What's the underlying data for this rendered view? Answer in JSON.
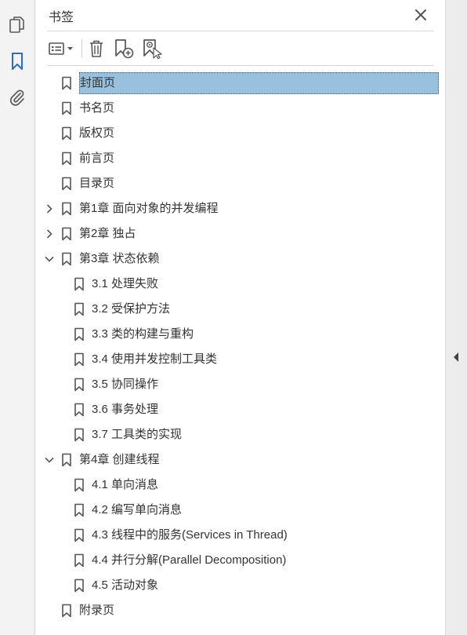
{
  "panel": {
    "title": "书签",
    "icons": {
      "close": "close-icon",
      "options": "options-menu-icon",
      "delete": "trash-icon",
      "new_bookmark": "new-bookmark-icon",
      "find_bookmark": "find-current-bookmark-icon",
      "pages": "pages-icon",
      "bookmarks": "bookmark-icon",
      "attachments": "paperclip-icon",
      "collapse": "collapse-left-icon"
    }
  },
  "colors": {
    "selection": "#99c1de",
    "active_rail_icon": "#2b6cc4"
  },
  "bookmarks": [
    {
      "label": "封面页",
      "level": 0,
      "toggle": "none",
      "selected": true
    },
    {
      "label": "书名页",
      "level": 0,
      "toggle": "none",
      "selected": false
    },
    {
      "label": "版权页",
      "level": 0,
      "toggle": "none",
      "selected": false
    },
    {
      "label": "前言页",
      "level": 0,
      "toggle": "none",
      "selected": false
    },
    {
      "label": "目录页",
      "level": 0,
      "toggle": "none",
      "selected": false
    },
    {
      "label": "第1章  面向对象的并发编程",
      "level": 0,
      "toggle": "collapsed",
      "selected": false
    },
    {
      "label": "第2章  独占",
      "level": 0,
      "toggle": "collapsed",
      "selected": false
    },
    {
      "label": "第3章  状态依赖",
      "level": 0,
      "toggle": "expanded",
      "selected": false
    },
    {
      "label": "3.1  处理失败",
      "level": 1,
      "toggle": "none",
      "selected": false
    },
    {
      "label": "3.2  受保护方法",
      "level": 1,
      "toggle": "none",
      "selected": false
    },
    {
      "label": "3.3  类的构建与重构",
      "level": 1,
      "toggle": "none",
      "selected": false
    },
    {
      "label": "3.4  使用并发控制工具类",
      "level": 1,
      "toggle": "none",
      "selected": false
    },
    {
      "label": "3.5  协同操作",
      "level": 1,
      "toggle": "none",
      "selected": false
    },
    {
      "label": "3.6  事务处理",
      "level": 1,
      "toggle": "none",
      "selected": false
    },
    {
      "label": "3.7  工具类的实现",
      "level": 1,
      "toggle": "none",
      "selected": false
    },
    {
      "label": "第4章  创建线程",
      "level": 0,
      "toggle": "expanded",
      "selected": false
    },
    {
      "label": "4.1  单向消息",
      "level": 1,
      "toggle": "none",
      "selected": false
    },
    {
      "label": "4.2  编写单向消息",
      "level": 1,
      "toggle": "none",
      "selected": false
    },
    {
      "label": "4.3  线程中的服务(Services in Thread)",
      "level": 1,
      "toggle": "none",
      "selected": false
    },
    {
      "label": "4.4  并行分解(Parallel Decomposition)",
      "level": 1,
      "toggle": "none",
      "selected": false
    },
    {
      "label": "4.5  活动对象",
      "level": 1,
      "toggle": "none",
      "selected": false
    },
    {
      "label": "附录页",
      "level": 0,
      "toggle": "none",
      "selected": false
    }
  ]
}
